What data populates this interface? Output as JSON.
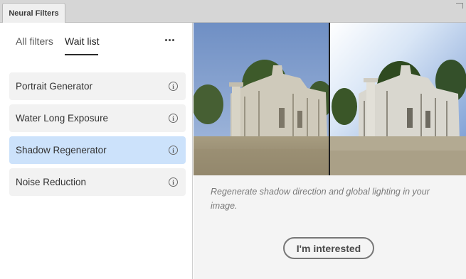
{
  "window": {
    "tab_title": "Neural Filters"
  },
  "filters": {
    "tabs": [
      {
        "label": "All filters",
        "active": false
      },
      {
        "label": "Wait list",
        "active": true
      }
    ],
    "more_icon": "ellipsis-icon",
    "items": [
      {
        "label": "Portrait Generator",
        "selected": false
      },
      {
        "label": "Water Long Exposure",
        "selected": false
      },
      {
        "label": "Shadow Regenerator",
        "selected": true
      },
      {
        "label": "Noise Reduction",
        "selected": false
      }
    ],
    "info_icon": "info-icon"
  },
  "detail": {
    "preview_image": "before-after ruins comparison",
    "description": "Regenerate shadow direction and global lighting in your image.",
    "cta_label": "I'm interested"
  },
  "colors": {
    "selected_bg": "#cce2fb",
    "panel_bg": "#f4f4f4",
    "item_bg": "#f2f2f2"
  }
}
